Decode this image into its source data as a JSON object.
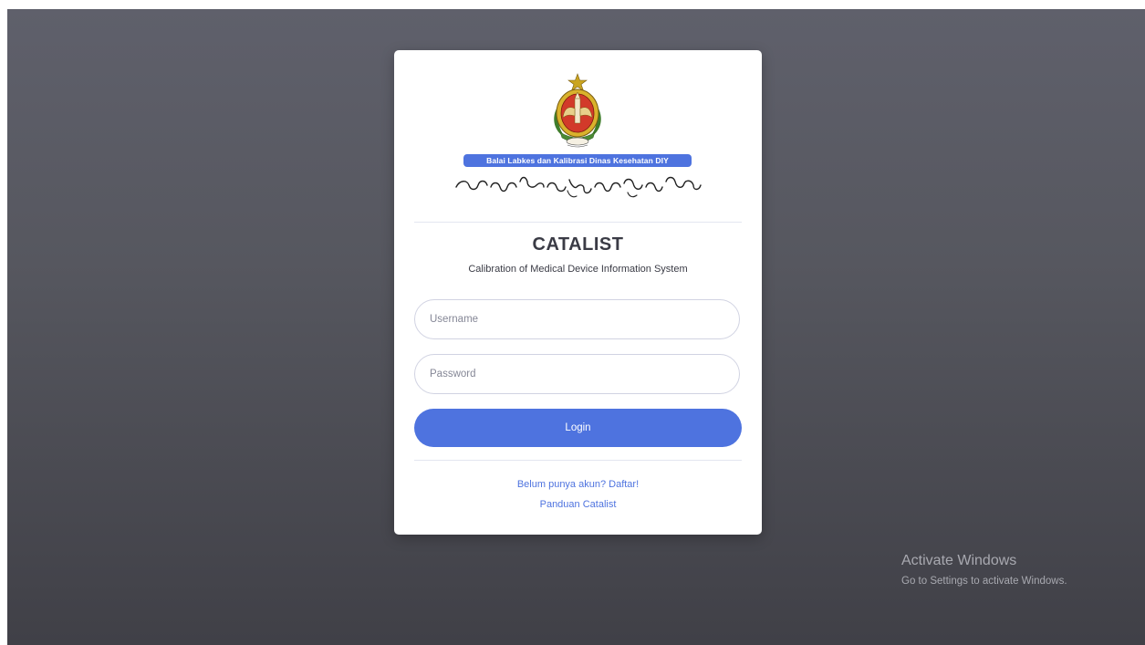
{
  "org": {
    "badge_text": "Balai Labkes dan Kalibrasi Dinas Kesehatan DIY",
    "logo_icon": "yogyakarta-coat-of-arms-icon",
    "script_icon": "javanese-script-logotype"
  },
  "app": {
    "title": "CATALIST",
    "subtitle": "Calibration of Medical Device Information System"
  },
  "form": {
    "username_placeholder": "Username",
    "password_placeholder": "Password",
    "login_label": "Login"
  },
  "links": {
    "register": "Belum punya akun? Daftar!",
    "guide": "Panduan Catalist"
  },
  "watermark": {
    "title": "Activate Windows",
    "subtitle": "Go to Settings to activate Windows."
  },
  "colors": {
    "primary": "#4e73df",
    "background_top": "#5f606b",
    "background_bottom": "#404047"
  }
}
